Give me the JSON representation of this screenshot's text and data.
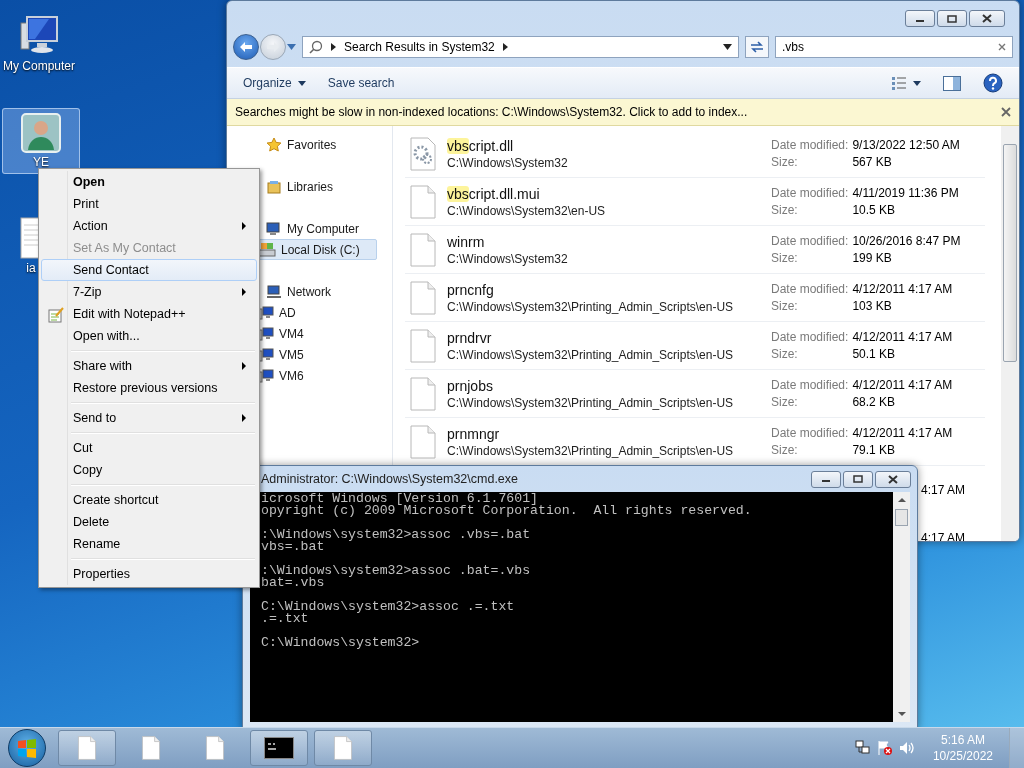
{
  "desktop_icons": [
    {
      "kind": "computer",
      "label": "My Computer",
      "selected": false
    },
    {
      "kind": "contact",
      "label": "YE",
      "selected": true
    },
    {
      "kind": "document",
      "label": "ia",
      "selected": false
    }
  ],
  "explorer": {
    "address": "Search Results in System32",
    "search": {
      "value": ".vbs"
    },
    "toolbar": [
      {
        "label": "Organize",
        "dropdown": true
      },
      {
        "label": "Save search",
        "dropdown": false
      }
    ],
    "info_bar": "Searches might be slow in non-indexed locations: C:\\Windows\\System32. Click to add to index...",
    "nav": [
      {
        "kind": "favorites",
        "label": "Favorites",
        "selected": false
      },
      {
        "kind": "libraries",
        "label": "Libraries",
        "selected": false
      },
      {
        "kind": "computer",
        "label": "My Computer",
        "selected": false,
        "children": [
          {
            "kind": "drive",
            "label": "Local Disk (C:)",
            "selected": true
          }
        ]
      },
      {
        "kind": "network",
        "label": "Network",
        "selected": false,
        "children": [
          {
            "kind": "pc",
            "label": "AD",
            "selected": false
          },
          {
            "kind": "pc",
            "label": "VM4",
            "selected": false
          },
          {
            "kind": "pc",
            "label": "VM5",
            "selected": false
          },
          {
            "kind": "pc",
            "label": "VM6",
            "selected": false
          }
        ]
      }
    ],
    "files": [
      {
        "kind": "dll",
        "name_match": "vbs",
        "name_rest": "cript.dll",
        "path": "C:\\Windows\\System32",
        "date_label": "Date modified:",
        "date": "9/13/2022 12:50 AM",
        "size_label": "Size:",
        "size": "567 KB"
      },
      {
        "kind": "file",
        "name_match": "vbs",
        "name_rest": "cript.dll.mui",
        "path": "C:\\Windows\\System32\\en-US",
        "date_label": "Date modified:",
        "date": "4/11/2019 11:36 PM",
        "size_label": "Size:",
        "size": "10.5 KB"
      },
      {
        "kind": "file",
        "name_rest": "winrm",
        "path": "C:\\Windows\\System32",
        "date_label": "Date modified:",
        "date": "10/26/2016 8:47 PM",
        "size_label": "Size:",
        "size": "199 KB"
      },
      {
        "kind": "file",
        "name_rest": "prncnfg",
        "path": "C:\\Windows\\System32\\Printing_Admin_Scripts\\en-US",
        "date_label": "Date modified:",
        "date": "4/12/2011 4:17 AM",
        "size_label": "Size:",
        "size": "103 KB"
      },
      {
        "kind": "file",
        "name_rest": "prndrvr",
        "path": "C:\\Windows\\System32\\Printing_Admin_Scripts\\en-US",
        "date_label": "Date modified:",
        "date": "4/12/2011 4:17 AM",
        "size_label": "Size:",
        "size": "50.1 KB"
      },
      {
        "kind": "file",
        "name_rest": "prnjobs",
        "path": "C:\\Windows\\System32\\Printing_Admin_Scripts\\en-US",
        "date_label": "Date modified:",
        "date": "4/12/2011 4:17 AM",
        "size_label": "Size:",
        "size": "68.2 KB"
      },
      {
        "kind": "file",
        "name_rest": "prnmngr",
        "path": "C:\\Windows\\System32\\Printing_Admin_Scripts\\en-US",
        "date_label": "Date modified:",
        "date": "4/12/2011 4:17 AM",
        "size_label": "Size:",
        "size": "79.1 KB"
      },
      {
        "kind": "covered",
        "date": "4:17 AM"
      },
      {
        "kind": "covered",
        "date": "4:17 AM"
      }
    ]
  },
  "context_menu": [
    {
      "kind": "item",
      "label": "Open",
      "default": true,
      "disabled": false,
      "selected": false,
      "submenu": false
    },
    {
      "kind": "item",
      "label": "Print",
      "default": false,
      "disabled": false,
      "selected": false,
      "submenu": false
    },
    {
      "kind": "item",
      "label": "Action",
      "default": false,
      "disabled": false,
      "selected": false,
      "submenu": true
    },
    {
      "kind": "item",
      "label": "Set As My Contact",
      "default": false,
      "disabled": true,
      "selected": false,
      "submenu": false
    },
    {
      "kind": "item",
      "label": "Send Contact",
      "default": false,
      "disabled": false,
      "selected": true,
      "submenu": false
    },
    {
      "kind": "item",
      "label": "7-Zip",
      "default": false,
      "disabled": false,
      "selected": false,
      "submenu": true
    },
    {
      "kind": "notepad",
      "label": "Edit with Notepad++",
      "default": false,
      "disabled": false,
      "selected": false,
      "submenu": false
    },
    {
      "kind": "item",
      "label": "Open with...",
      "default": false,
      "disabled": false,
      "selected": false,
      "submenu": false
    },
    {
      "kind": "separator"
    },
    {
      "kind": "item",
      "label": "Share with",
      "default": false,
      "disabled": false,
      "selected": false,
      "submenu": true
    },
    {
      "kind": "item",
      "label": "Restore previous versions",
      "default": false,
      "disabled": false,
      "selected": false,
      "submenu": false
    },
    {
      "kind": "separator"
    },
    {
      "kind": "item",
      "label": "Send to",
      "default": false,
      "disabled": false,
      "selected": false,
      "submenu": true
    },
    {
      "kind": "separator"
    },
    {
      "kind": "item",
      "label": "Cut",
      "default": false,
      "disabled": false,
      "selected": false,
      "submenu": false
    },
    {
      "kind": "item",
      "label": "Copy",
      "default": false,
      "disabled": false,
      "selected": false,
      "submenu": false
    },
    {
      "kind": "separator"
    },
    {
      "kind": "item",
      "label": "Create shortcut",
      "default": false,
      "disabled": false,
      "selected": false,
      "submenu": false
    },
    {
      "kind": "item",
      "label": "Delete",
      "default": false,
      "disabled": false,
      "selected": false,
      "submenu": false
    },
    {
      "kind": "item",
      "label": "Rename",
      "default": false,
      "disabled": false,
      "selected": false,
      "submenu": false
    },
    {
      "kind": "separator"
    },
    {
      "kind": "item",
      "label": "Properties",
      "default": false,
      "disabled": false,
      "selected": false,
      "submenu": false
    }
  ],
  "cmd": {
    "title": "Administrator: C:\\Windows\\System32\\cmd.exe",
    "blocks": [
      [
        "icrosoft Windows [Version 6.1.7601]",
        "opyright (c) 2009 Microsoft Corporation.  All rights reserved."
      ],
      [
        ":\\Windows\\system32>assoc .vbs=.bat",
        "vbs=.bat"
      ],
      [
        ":\\Windows\\system32>assoc .bat=.vbs",
        "bat=.vbs"
      ],
      [
        "C:\\Windows\\system32>assoc .=.txt",
        ".=.txt"
      ],
      [
        "C:\\Windows\\system32>"
      ]
    ]
  },
  "taskbar": {
    "buttons": [
      {
        "kind": "document",
        "running": true
      },
      {
        "kind": "document",
        "running": false
      },
      {
        "kind": "document",
        "running": false
      },
      {
        "kind": "console",
        "running": true
      },
      {
        "kind": "document",
        "running": true
      }
    ],
    "clock": {
      "time": "5:16 AM",
      "date": "10/25/2022"
    }
  }
}
